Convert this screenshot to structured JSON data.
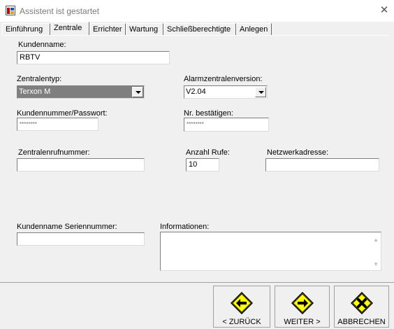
{
  "window": {
    "title": "Assistent ist gestartet"
  },
  "tabs": [
    "Einführung",
    "Zentrale",
    "Errichter",
    "Wartung",
    "Schließberechtigte",
    "Anlegen"
  ],
  "form": {
    "kundenname_label": "Kundenname:",
    "kundenname_value": "RBTV",
    "zentralentyp_label": "Zentralentyp:",
    "zentralentyp_value": "Terxon M",
    "alarmversion_label": "Alarmzentralenversion:",
    "alarmversion_value": "V2.04",
    "kundennummer_label": "Kundennummer/Passwort:",
    "kundennummer_value": "********",
    "bestaetigen_label": "Nr. bestätigen:",
    "bestaetigen_value": "********",
    "rufnummer_label": "Zentralenrufnummer:",
    "anzahl_rufe_label": "Anzahl Rufe:",
    "anzahl_rufe_value": "10",
    "netzwerk_label": "Netzwerkadresse:",
    "serien_label": "Kundenname Seriennummer:",
    "info_label": "Informationen:"
  },
  "nav": {
    "back": "< ZURÜCK",
    "next": "WEITER >",
    "cancel": "ABBRECHEN"
  },
  "colors": {
    "sign_yellow": "#ffff00",
    "select_highlight": "#7f7f7f"
  }
}
